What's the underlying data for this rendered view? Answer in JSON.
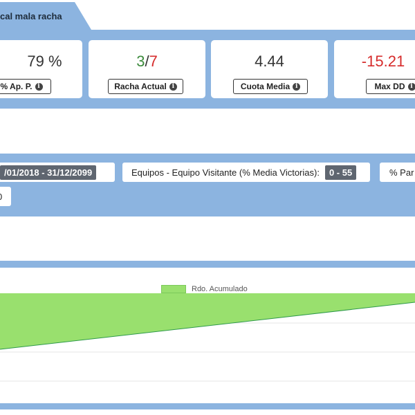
{
  "tab": {
    "label": "cal mala racha"
  },
  "stats": [
    {
      "id": "ap",
      "value": "79 %",
      "label": "% Ap. P."
    },
    {
      "id": "racha",
      "value_current": "3",
      "value_sep": "/",
      "value_max": "7",
      "label": "Racha Actual"
    },
    {
      "id": "cuota",
      "value": "4.44",
      "label": "Cuota Media"
    },
    {
      "id": "maxdd",
      "value": "-15.21",
      "label": "Max DD"
    }
  ],
  "filters": {
    "date_range": "/01/2018 - 31/12/2099",
    "visitor_label": "Equipos - Equipo Visitante (% Media Victorias):",
    "visitor_value": "0 - 55",
    "partial_label": "% Par",
    "second_row_value": "0"
  },
  "chart_data": {
    "type": "area",
    "series": [
      {
        "name": "Rdo. Acumulado",
        "color": "#99e06e",
        "line_color": "#2e9a4a"
      }
    ],
    "legend_position": "top-center"
  }
}
